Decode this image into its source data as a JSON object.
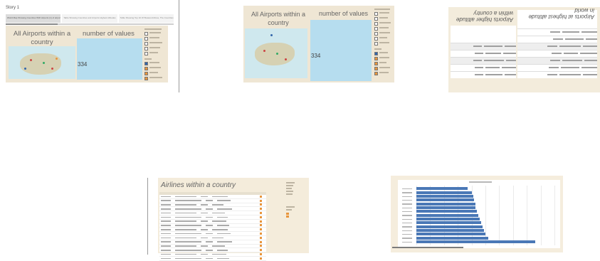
{
  "story": {
    "title": "Story 1",
    "tabs": [
      {
        "label": "World Map Showing Countries With Airports (1) of airports",
        "active": true
      },
      {
        "label": "Table Showing Countries and Airports Highest Altitudes",
        "active": false
      },
      {
        "label": "Table Showing Top 10 Of Busiest Airlines, The Countries",
        "active": false
      }
    ]
  },
  "dashboards": [
    {
      "title": "All Airports within a country",
      "value_heading": "number of values",
      "value": "334"
    },
    {
      "title": "All Airports within a country",
      "value_heading": "number of values",
      "value": "334"
    }
  ],
  "mirrored": {
    "left_title": "Airports at highest altitude in world",
    "right_title": "Airports higher altitude within a country"
  },
  "airlines": {
    "title": "Airlines within a country"
  },
  "colors": {
    "panel": "#efe6d4",
    "value_box": "#b6ddef",
    "map_water": "#cfe8ee",
    "bar": "#4a78b6",
    "legend_orange": "#e8953c"
  },
  "chart_data": {
    "type": "bar",
    "orientation": "horizontal",
    "values": [
      37,
      40,
      41,
      42,
      43,
      43,
      44,
      45,
      46,
      47,
      48,
      49,
      50,
      52,
      86
    ],
    "grid": true
  }
}
